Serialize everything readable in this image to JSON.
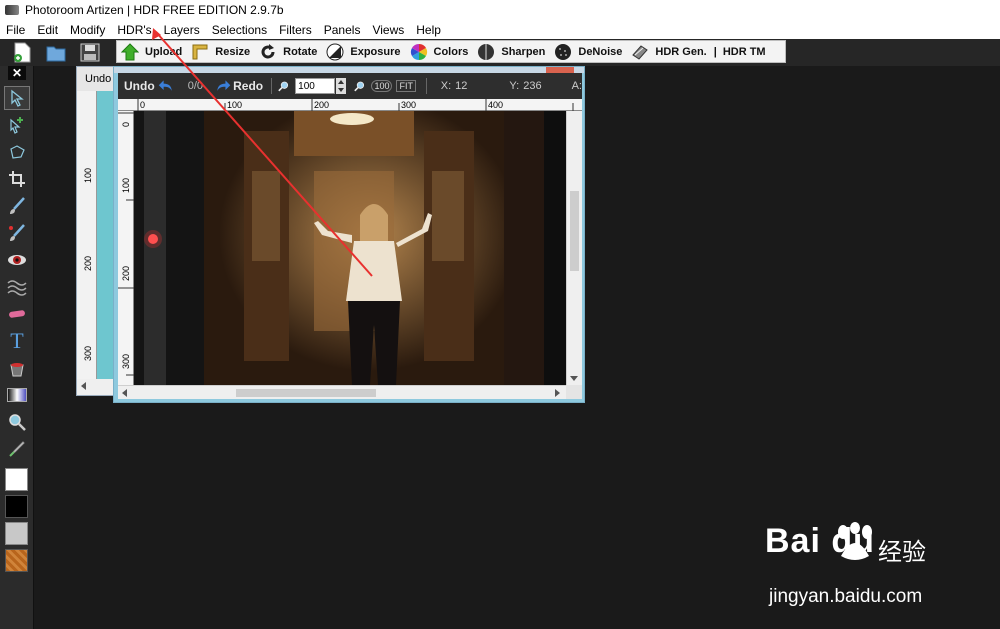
{
  "window": {
    "title": "Photoroom Artizen | HDR FREE EDITION 2.9.7b"
  },
  "menu": [
    "File",
    "Edit",
    "Modify",
    "HDR's",
    "Layers",
    "Selections",
    "Filters",
    "Panels",
    "Views",
    "Help"
  ],
  "toolbar": {
    "buttons": [
      "Upload",
      "Resize",
      "Rotate",
      "Exposure",
      "Colors",
      "Sharpen",
      "DeNoise",
      "HDR Gen."
    ],
    "hdr_tm": "HDR TM",
    "separator": "|"
  },
  "left_panel": {
    "close_glyph": "✕",
    "tools": [
      "select-arrow-icon",
      "add-select-icon",
      "lasso-icon",
      "crop-icon",
      "brush-icon",
      "clone-brush-icon",
      "red-eye-icon",
      "wave-icon",
      "eraser-icon",
      "text-icon",
      "bucket-icon",
      "gradient-icon",
      "zoom-icon",
      "eyedropper-icon"
    ],
    "text_tool_glyph": "T",
    "colors": {
      "foreground": "#ffffff",
      "background": "#000000",
      "third": "#c8c8c8",
      "pattern": "#b8651c"
    }
  },
  "back_document": {
    "undo_label": "Undo",
    "ruler_v_labels": [
      "100",
      "200",
      "300"
    ]
  },
  "document": {
    "undo_label": "Undo",
    "history_counter": "0/0",
    "redo_label": "Redo",
    "zoom_value": "100",
    "zoom_100_label": "100",
    "fit_label": "FIT",
    "x_label": "X:",
    "x_value": "12",
    "y_label": "Y:",
    "y_value": "236",
    "a_label": "A:",
    "ruler_h_labels": [
      "0",
      "100",
      "200",
      "300",
      "400"
    ],
    "ruler_v_labels": [
      "0",
      "100",
      "200",
      "300"
    ]
  },
  "watermark": {
    "brand": "Bai du",
    "cn": "经验",
    "url": "jingyan.baidu.com"
  },
  "colors": {
    "annotation_arrow": "#e8312f",
    "app_dark": "#1b1b1b",
    "doc_frame": "#8ec9de"
  }
}
